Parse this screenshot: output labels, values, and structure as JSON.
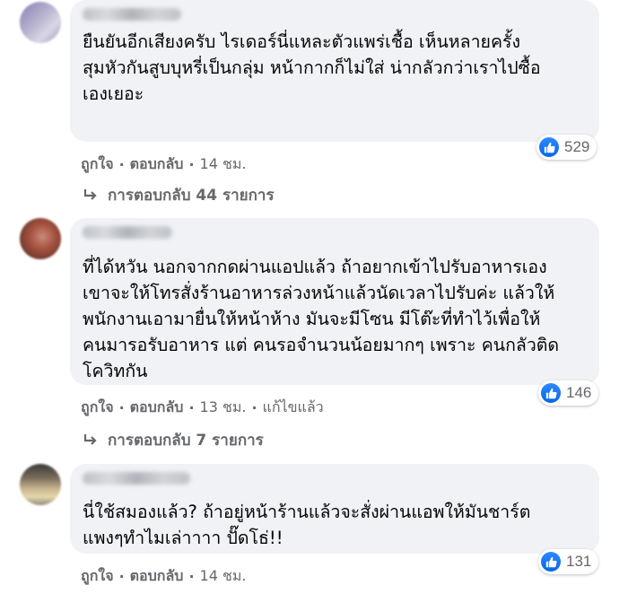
{
  "comments": [
    {
      "text": "ยืนยันอีกเสียงครับ ไรเดอร์นี่แหละตัวแพร่เชื้อ เห็นหลายครั้ง\nสุมหัวกันสูบบุหรี่เป็นกลุ่ม หน้ากากก็ไม่ใส่ น่ากลัวกว่าเราไปซื้อ\nเองเยอะ",
      "reaction_count": "529",
      "like_label": "ถูกใจ",
      "reply_label": "ตอบกลับ",
      "time": "14 ชม.",
      "replies_label": "การตอบกลับ 44 รายการ"
    },
    {
      "text": "ที่ได้หวัน นอกจากกดผ่านแอปแล้ว ถ้าอยากเข้าไปรับอาหารเอง\nเขาจะให้โทรสั่งร้านอาหารล่วงหน้าแล้วนัดเวลาไปรับค่ะ แล้วให้\nพนักงานเอามายื่นให้หน้าห้าง มันจะมีโซน มีโต๊ะที่ทำไว้เพื่อให้\nคนมารอรับอาหาร แต่ คนรอจำนวนน้อยมากๆ เพราะ คนกลัวติด\nโควิทกัน",
      "reaction_count": "146",
      "like_label": "ถูกใจ",
      "reply_label": "ตอบกลับ",
      "time": "13 ชม.",
      "edited_label": "แก้ไขแล้ว",
      "replies_label": "การตอบกลับ 7 รายการ"
    },
    {
      "text": "นี่ใช้สมองแล้ว? ถ้าอยู่หน้าร้านแล้วจะสั่งผ่านแอพให้มันชาร์ต\nแพงๆทำไมเล่าาาา ปั๊ดโธ่!!",
      "reaction_count": "131",
      "like_label": "ถูกใจ",
      "reply_label": "ตอบกลับ",
      "time": "14 ชม."
    }
  ],
  "icons": {
    "like": "thumbs-up-icon",
    "reply_arrow": "reply-arrow-icon"
  },
  "colors": {
    "bubble": "#f0f2f5",
    "like_blue": "#1877f2",
    "meta_text": "#65676b"
  }
}
